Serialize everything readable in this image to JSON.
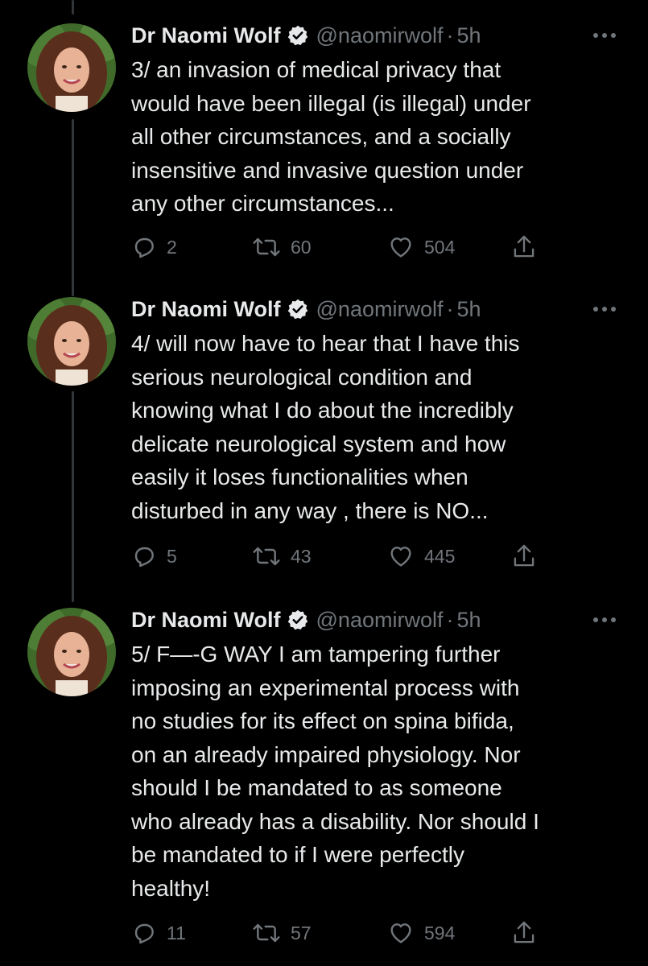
{
  "tweets": [
    {
      "name": "Dr Naomi Wolf",
      "handle": "@naomirwolf",
      "separator": "·",
      "time": "5h",
      "text": "3/ an invasion of medical privacy that\nwould have been illegal (is illegal) under\nall other circumstances, and a socially\ninsensitive and invasive question under\nany other circumstances...",
      "replies": "2",
      "retweets": "60",
      "likes": "504"
    },
    {
      "name": "Dr Naomi Wolf",
      "handle": "@naomirwolf",
      "separator": "·",
      "time": "5h",
      "text": "4/ will now have to hear that I have this\nserious neurological condition and\nknowing what I do about the incredibly\ndelicate neurological system and how\neasily it loses functionalities when\ndisturbed in any way , there is NO...",
      "replies": "5",
      "retweets": "43",
      "likes": "445"
    },
    {
      "name": "Dr Naomi Wolf",
      "handle": "@naomirwolf",
      "separator": "·",
      "time": "5h",
      "text": "5/ F—-G WAY I am tampering further\nimposing an experimental process with\nno studies for its effect on spina bifida,\non an already impaired physiology. Nor\nshould I be mandated to as someone\nwho already has a disability. Nor should I\nbe mandated to if I were perfectly\nhealthy!",
      "replies": "11",
      "retweets": "57",
      "likes": "594"
    }
  ],
  "icons": {
    "reply": "reply-icon",
    "retweet": "retweet-icon",
    "like": "heart-icon",
    "share": "share-icon",
    "more": "more-options-icon",
    "verified": "verified-badge-icon"
  },
  "colors": {
    "background": "#000000",
    "text": "#e7e9ea",
    "secondary": "#71767b",
    "thread_line": "#333639"
  }
}
